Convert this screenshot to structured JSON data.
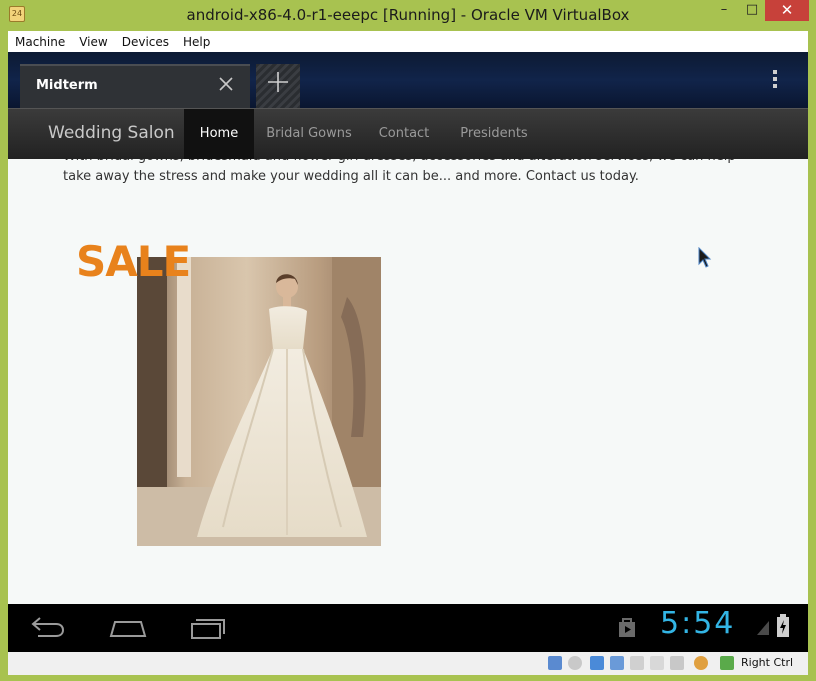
{
  "window": {
    "title": "android-x86-4.0-r1-eeepc [Running] - Oracle VM VirtualBox",
    "icon_text": "24",
    "minimize_icon": "minimize-icon",
    "maximize_icon": "maximize-icon",
    "close_icon": "close-icon"
  },
  "menubar": {
    "items": [
      "Machine",
      "View",
      "Devices",
      "Help"
    ]
  },
  "browser": {
    "tab_title": "Midterm",
    "tab_close_icon": "close-icon",
    "new_tab_icon": "plus-icon",
    "overflow_icon": "overflow-menu-icon"
  },
  "site": {
    "brand": "Wedding Salon",
    "nav": [
      "Home",
      "Bridal Gowns",
      "Contact",
      "Presidents"
    ],
    "active_nav": "Home",
    "intro": "With bridal gowns, bridesmaid and flower girl dresses, accessories and alteration services, we can help take away the stress and make your wedding all it can be... and more. Contact us today.",
    "sale_label": "SALE",
    "sale_color": "#e8821c"
  },
  "android": {
    "back_icon": "back-icon",
    "home_icon": "home-icon",
    "recent_icon": "recent-apps-icon",
    "store_icon": "shopping-bag-icon",
    "clock": "5:54",
    "clock_color": "#33b5e5"
  },
  "statusbar": {
    "host_key": "Right Ctrl"
  }
}
